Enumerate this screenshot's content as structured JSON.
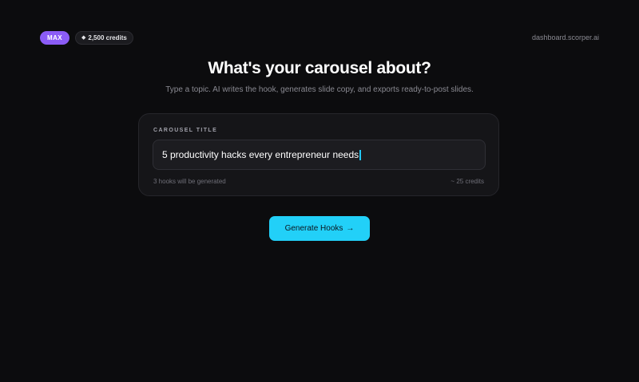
{
  "header": {
    "plan_badge": "MAX",
    "credits_icon": "diamond-icon",
    "credits_label": "2,500 credits",
    "domain": "dashboard.scorper.ai"
  },
  "hero": {
    "title": "What's your carousel about?",
    "subtitle": "Type a topic. AI writes the hook, generates slide copy, and exports ready-to-post slides."
  },
  "form": {
    "label": "CAROUSEL TITLE",
    "input_value": "5 productivity hacks every entrepreneur needs",
    "hooks_note": "3 hooks will be generated",
    "cost_note": "~ 25 credits"
  },
  "actions": {
    "generate_label": "Generate Hooks",
    "generate_icon": "arrow-right-icon"
  },
  "colors": {
    "accent": "#22d0f8",
    "plan_badge": "#8b5cf6",
    "background": "#0c0c0e"
  }
}
